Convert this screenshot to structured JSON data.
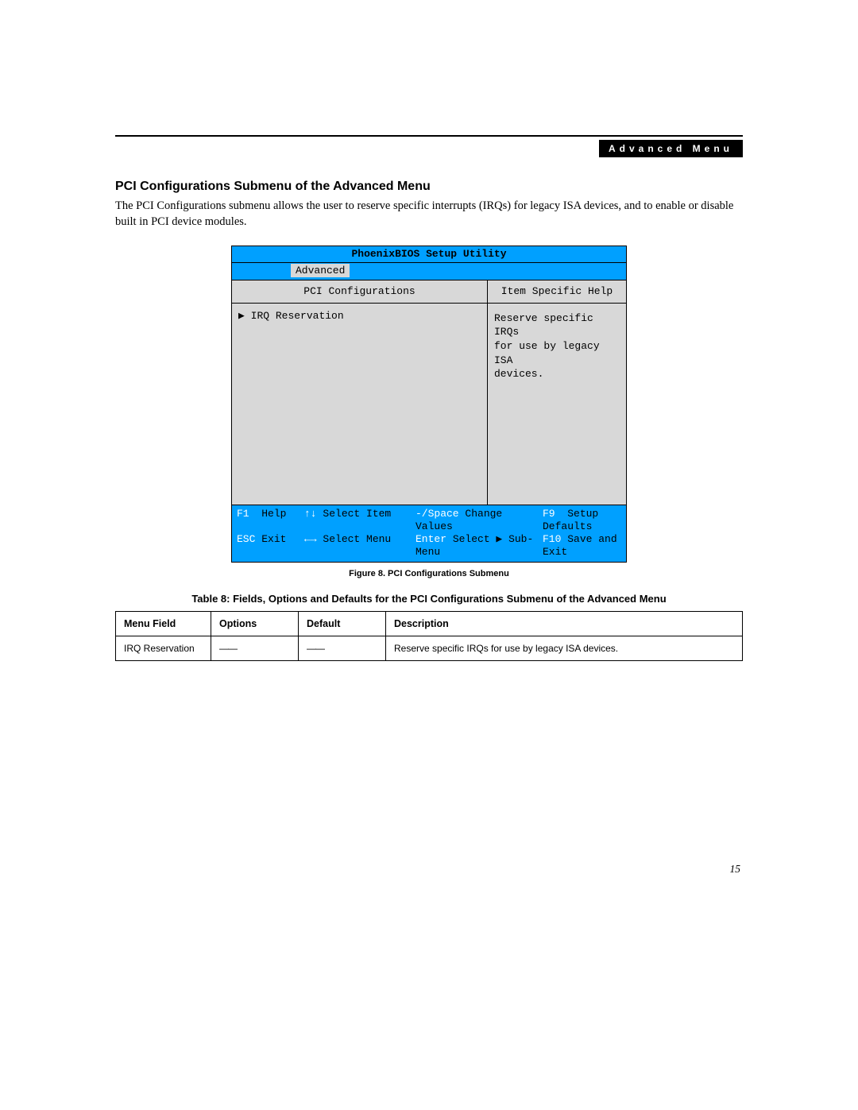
{
  "header": {
    "label": "Advanced Menu"
  },
  "section": {
    "title": "PCI Configurations Submenu of the Advanced Menu",
    "body": "The PCI Configurations submenu allows the user to reserve specific interrupts (IRQs) for legacy ISA devices, and to enable or disable built in PCI device modules."
  },
  "bios": {
    "title": "PhoenixBIOS Setup Utility",
    "tab_selected": "Advanced",
    "left_header": "PCI Configurations",
    "item": "IRQ Reservation",
    "right_header": "Item Specific Help",
    "help_line1": "Reserve specific IRQs",
    "help_line2": "for use by legacy ISA",
    "help_line3": "devices.",
    "footer": {
      "r1": {
        "k1": "F1",
        "t1": "Help",
        "k2": "↑↓",
        "t2": "Select Item",
        "k3": "-/Space",
        "t3": "Change Values",
        "k4": "F9",
        "t4": "Setup Defaults"
      },
      "r2": {
        "k1": "ESC",
        "t1": "Exit",
        "k2": "←→",
        "t2": "Select Menu",
        "k3": "Enter",
        "t3": "Select ▶ Sub-Menu",
        "k4": "F10",
        "t4": "Save and Exit"
      }
    }
  },
  "figure_caption": "Figure 8.  PCI Configurations Submenu",
  "table_caption": "Table 8: Fields, Options and Defaults for the PCI Configurations Submenu of the Advanced Menu",
  "table": {
    "headers": {
      "c1": "Menu Field",
      "c2": "Options",
      "c3": "Default",
      "c4": "Description"
    },
    "row": {
      "c1": "IRQ Reservation",
      "c2": "——",
      "c3": "——",
      "c4": "Reserve specific IRQs for use by legacy ISA devices."
    }
  },
  "page_number": "15"
}
